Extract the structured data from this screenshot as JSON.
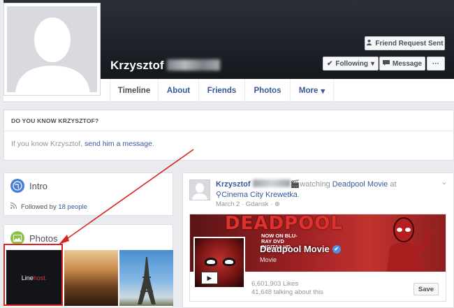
{
  "profile": {
    "first_name": "Krzysztof"
  },
  "header_buttons": {
    "friend_request": "Friend Request Sent",
    "following": "Following",
    "message": "Message",
    "more": "···"
  },
  "tabs": [
    {
      "label": "Timeline"
    },
    {
      "label": "About"
    },
    {
      "label": "Friends"
    },
    {
      "label": "Photos"
    },
    {
      "label": "More"
    }
  ],
  "know_box": {
    "heading": "DO YOU KNOW KRZYSZTOF?",
    "text_prefix": "If you know Krzysztof, ",
    "link": "send him a message",
    "text_suffix": "."
  },
  "intro": {
    "title": "Intro",
    "followed_prefix": "Followed by ",
    "followed_link": "18 people"
  },
  "photos": {
    "title": "Photos",
    "thumb1_text": "Line",
    "thumb1_accent": "host."
  },
  "post": {
    "author": "Krzysztof",
    "action": "watching",
    "movie_link": "Deadpool Movie",
    "at": "at",
    "place": "Cinema City Krewetka",
    "date": "March 2",
    "location": "Gdansk"
  },
  "movie_card": {
    "cover_text": "DEADPOOL",
    "cover_small": "NOW ON BLU-RAY DVD DIGITAL HD",
    "title": "Deadpool Movie",
    "type": "Movie",
    "likes": "6,601,903 Likes",
    "talking": "41,648 talking about this",
    "save": "Save"
  },
  "colors": {
    "link": "#365899",
    "cover": "#1d2129",
    "annotation": "#d9241f",
    "intro_icon": "#4a7dd4",
    "photos_icon": "#8bc34a"
  }
}
